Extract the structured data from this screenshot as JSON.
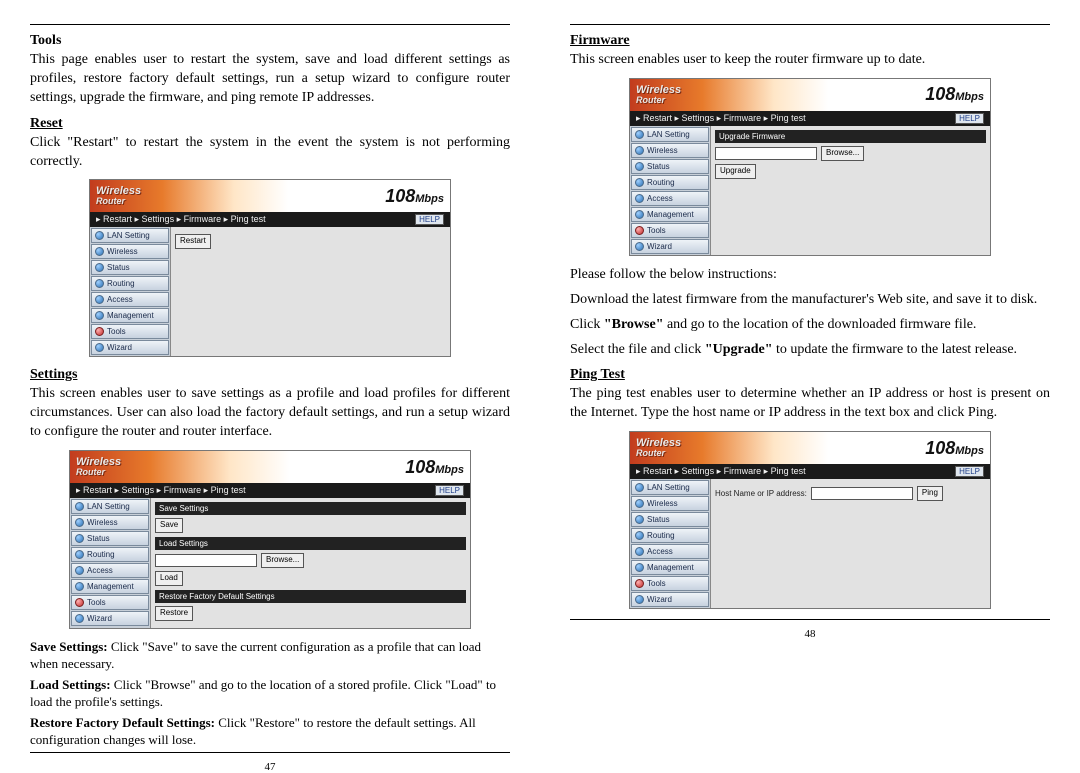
{
  "left": {
    "page_num": "47",
    "sections": {
      "tools": {
        "heading": "Tools",
        "desc": "This page enables user to restart the system, save and load different settings as profiles, restore factory default settings, run a setup wizard to configure router settings, upgrade the firmware, and ping remote IP addresses."
      },
      "reset": {
        "heading": "Reset",
        "desc": "Click \"Restart\" to restart the system in the event the system is not performing correctly."
      },
      "settings": {
        "heading": "Settings",
        "desc": "This screen enables user to save settings as a profile and load profiles for different circumstances. User can also load the factory default settings, and run a setup wizard to configure the router and router interface.",
        "save_line": [
          {
            "b": "Save Settings: "
          },
          {
            "t": "Click \"Save\" to save the current configuration as a profile that can load when necessary."
          }
        ],
        "load_line": [
          {
            "b": "Load Settings: "
          },
          {
            "t": "Click \"Browse\" and go to the location of a stored profile. Click \"Load\" to load the profile's settings."
          }
        ],
        "restore_line": [
          {
            "b": "Restore Factory Default Settings: "
          },
          {
            "t": "Click \"Restore\" to restore the default settings. All configuration changes will lose."
          }
        ]
      }
    }
  },
  "right": {
    "page_num": "48",
    "sections": {
      "firmware": {
        "heading": "Firmware",
        "desc": "This screen enables user to keep the router firmware up to date.",
        "inst_intro": "Please follow the below instructions:",
        "inst1": "Download the latest firmware from the manufacturer's Web site, and save it to disk.",
        "inst2a": "Click ",
        "inst2b": "\"Browse\"",
        "inst2c": " and go to the location of the downloaded firmware file.",
        "inst3a": "Select the file and click ",
        "inst3b": "\"Upgrade\"",
        "inst3c": " to update the firmware to the latest release."
      },
      "ping": {
        "heading": "Ping Test",
        "desc": "The ping test enables user to determine whether an IP address or host is present on the Internet. Type the host name or IP address in the text box and click Ping."
      }
    }
  },
  "router": {
    "logo_line1": "Wireless",
    "logo_line2": "Router",
    "speed_main": "108",
    "speed_suffix": "Mbps",
    "help": "HELP",
    "crumb": "▸ Restart  ▸ Settings  ▸ Firmware  ▸ Ping test",
    "nav": [
      {
        "label": "LAN Setting"
      },
      {
        "label": "Wireless"
      },
      {
        "label": "Status"
      },
      {
        "label": "Routing"
      },
      {
        "label": "Access"
      },
      {
        "label": "Management"
      },
      {
        "label": "Tools",
        "sel": true
      },
      {
        "label": "Wizard"
      }
    ],
    "panels": {
      "reset": {
        "restart_btn": "Restart"
      },
      "settings": {
        "t1": "Save Settings",
        "save_btn": "Save",
        "t2": "Load Settings",
        "browse_btn": "Browse...",
        "load_btn": "Load",
        "t3": "Restore Factory Default Settings",
        "restore_btn": "Restore"
      },
      "firmware": {
        "t1": "Upgrade Firmware",
        "browse_btn": "Browse...",
        "upgrade_btn": "Upgrade"
      },
      "ping": {
        "lbl": "Host Name or IP address:",
        "ping_btn": "Ping"
      }
    }
  }
}
